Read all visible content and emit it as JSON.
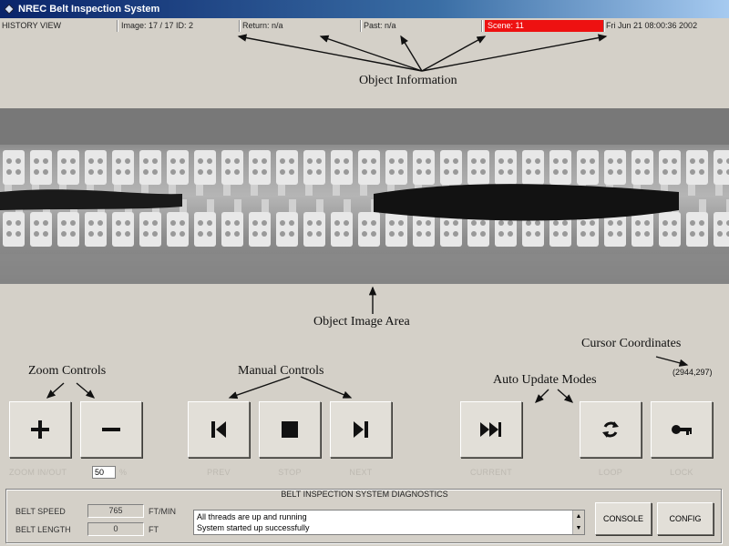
{
  "window": {
    "title": "NREC Belt Inspection System"
  },
  "info": {
    "mode": "HISTORY VIEW",
    "image": "Image: 17 / 17  ID: 2",
    "return": "Return: n/a",
    "past": "Past: n/a",
    "scene": "Scene: 11",
    "datetime": "Fri Jun 21 08:00:36 2002",
    "scene_color": "#ee1111"
  },
  "annotations": {
    "object_information": "Object Information",
    "object_image_area": "Object Image Area",
    "zoom_controls": "Zoom Controls",
    "manual_controls": "Manual Controls",
    "auto_update_modes": "Auto Update Modes",
    "cursor_coordinates": "Cursor Coordinates",
    "cursor_value": "(2944,297)"
  },
  "controls": {
    "zoom_caption": "ZOOM IN/OUT",
    "zoom_value": "50",
    "zoom_unit": "%",
    "prev": "PREV",
    "stop": "STOP",
    "next": "NEXT",
    "current": "CURRENT",
    "loop": "LOOP",
    "lock": "LOCK"
  },
  "diagnostics": {
    "title": "BELT INSPECTION SYSTEM DIAGNOSTICS",
    "speed_label": "BELT SPEED",
    "speed_value": "765",
    "speed_unit": "FT/MIN",
    "length_label": "BELT LENGTH",
    "length_value": "0",
    "length_unit": "FT",
    "log": [
      "All threads are up and running",
      "System started up successfully"
    ],
    "console": "CONSOLE",
    "config": "CONFIG"
  },
  "icons": [
    "app-icon",
    "plus-icon",
    "minus-icon",
    "prev-icon",
    "stop-icon",
    "next-icon",
    "fast-forward-icon",
    "loop-icon",
    "key-icon",
    "scroll-up-icon",
    "scroll-down-icon"
  ]
}
